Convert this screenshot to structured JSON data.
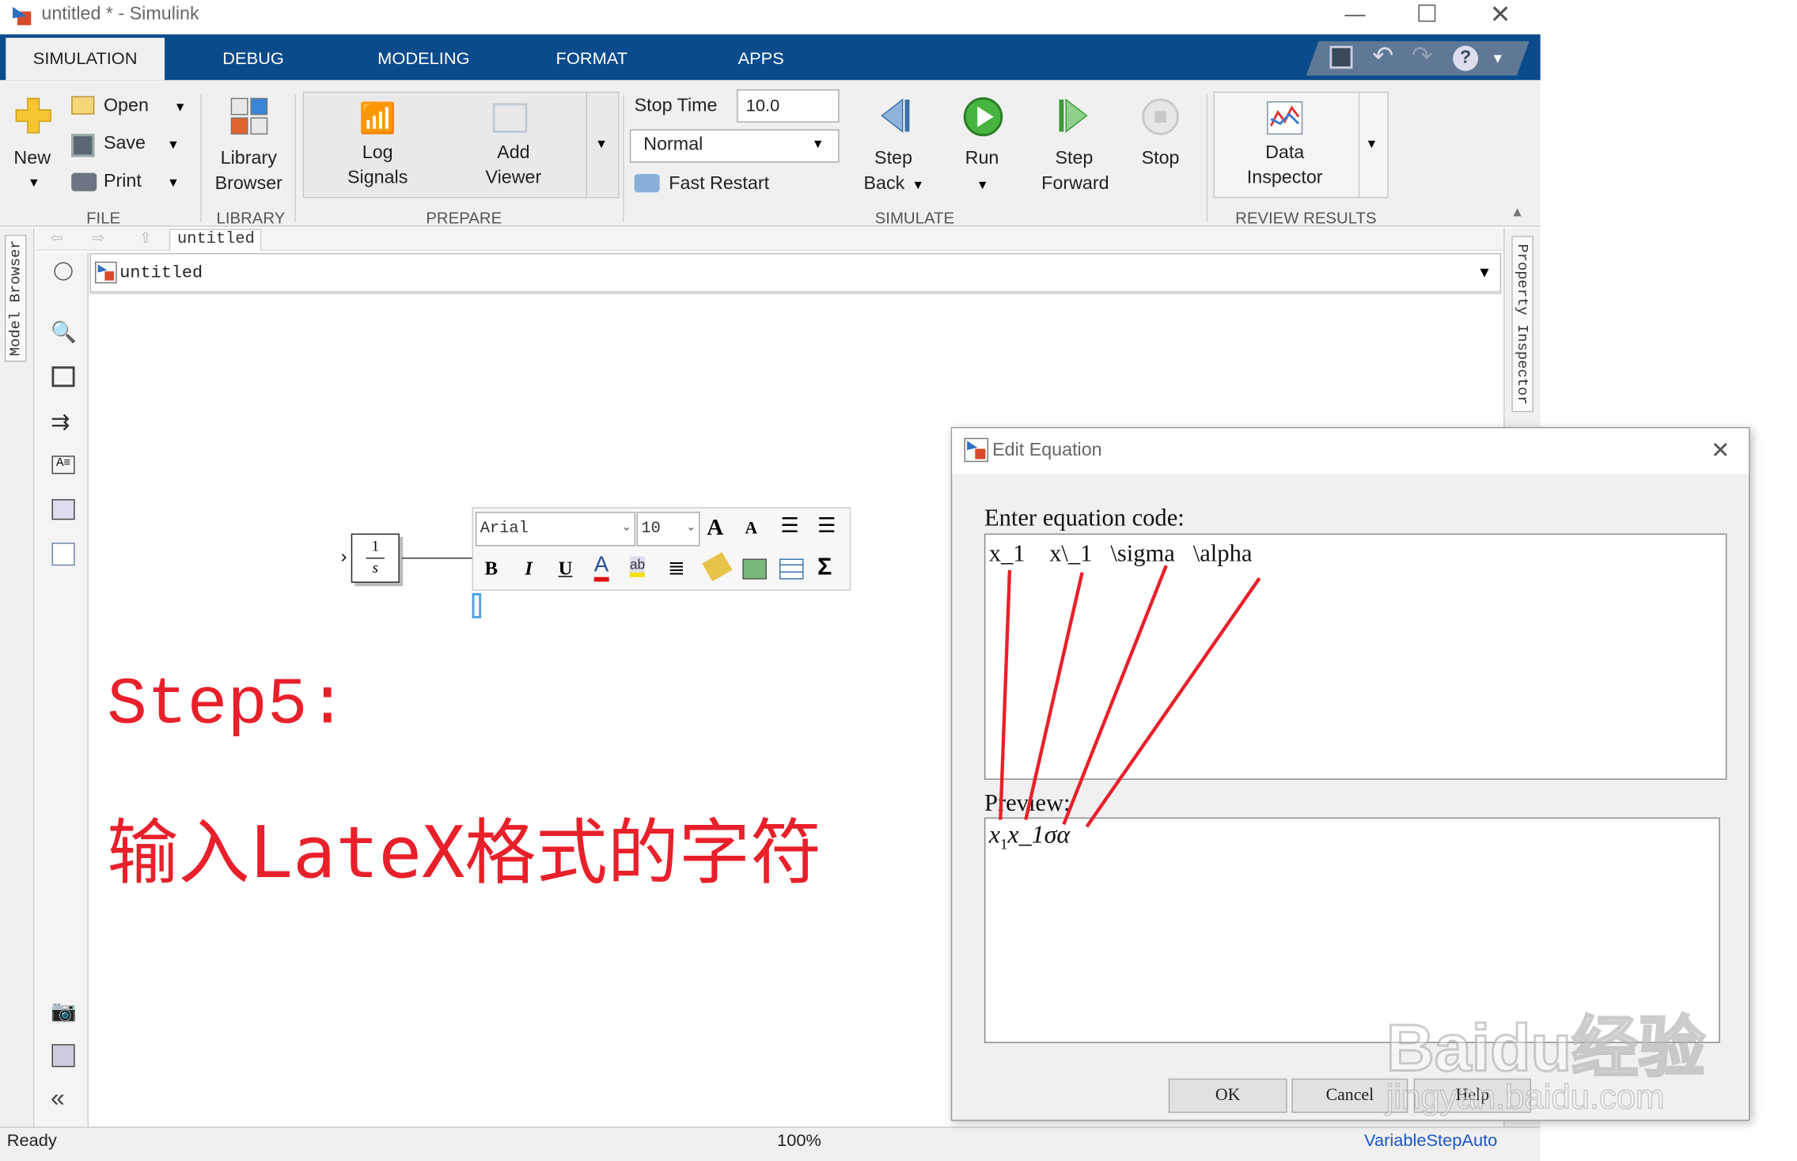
{
  "window": {
    "title": "untitled * - Simulink"
  },
  "tabs": [
    "SIMULATION",
    "DEBUG",
    "MODELING",
    "FORMAT",
    "APPS"
  ],
  "file": {
    "new": "New",
    "open": "Open",
    "save": "Save",
    "print": "Print",
    "group": "FILE"
  },
  "library": {
    "line1": "Library",
    "line2": "Browser",
    "group": "LIBRARY"
  },
  "prepare": {
    "log1": "Log",
    "log2": "Signals",
    "add1": "Add",
    "add2": "Viewer",
    "group": "PREPARE"
  },
  "simulate": {
    "stop_time_label": "Stop Time",
    "stop_time_value": "10.0",
    "mode": "Normal",
    "fast_restart": "Fast Restart",
    "step_back1": "Step",
    "step_back2": "Back",
    "run": "Run",
    "step_fwd1": "Step",
    "step_fwd2": "Forward",
    "stop": "Stop",
    "group": "SIMULATE"
  },
  "review": {
    "line1": "Data",
    "line2": "Inspector",
    "group": "REVIEW RESULTS"
  },
  "breadcrumb": {
    "tab": "untitled",
    "path": "untitled"
  },
  "side": {
    "model_browser": "Model Browser",
    "property_inspector": "Property Inspector"
  },
  "block": {
    "num": "1",
    "den": "s"
  },
  "format_bar": {
    "font": "Arial",
    "size": "10"
  },
  "annotation": {
    "line1": "Step5:",
    "line2": "输入LateX格式的字符"
  },
  "dialog": {
    "title": "Edit Equation",
    "prompt": "Enter equation code:",
    "code": "x_1    x\\_1   \\sigma   \\alpha",
    "preview_label": "Preview:",
    "ok": "OK",
    "cancel": "Cancel",
    "help": "Help"
  },
  "status": {
    "left": "Ready",
    "zoom": "100%",
    "solver": "VariableStepAuto"
  },
  "watermark": {
    "line1": "Baidu经验",
    "line2": "jingyan.baidu.com"
  },
  "colors": {
    "tabbar": "#0a4b8c",
    "annotation": "#e8202a",
    "link": "#1a55c8"
  }
}
